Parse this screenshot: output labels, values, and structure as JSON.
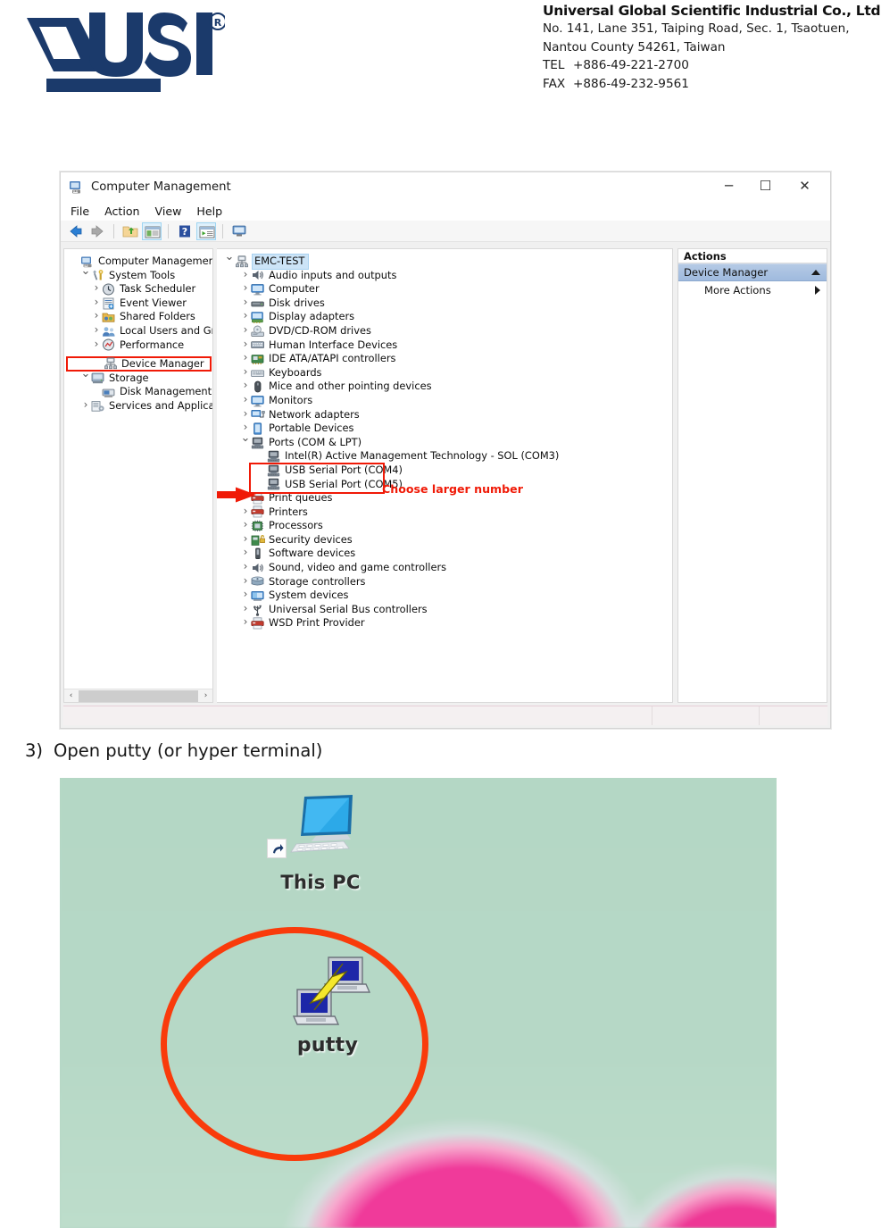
{
  "letterhead": {
    "logo_text": "USI",
    "logo_mark": "usi-logo",
    "company_name": "Universal Global Scientific Industrial Co., Ltd.",
    "address_line1": "No. 141, Lane 351, Taiping Road, Sec. 1, Tsaotuen,",
    "address_line2": "Nantou County 54261, Taiwan",
    "tel_label": "TEL",
    "tel_value": "+886-49-221-2700",
    "fax_label": "FAX",
    "fax_value": "+886-49-232-9561"
  },
  "window": {
    "title": "Computer Management",
    "title_icon": "computer-management-icon",
    "controls": {
      "minimize": "─",
      "maximize": "☐",
      "close": "✕"
    },
    "menu": [
      "File",
      "Action",
      "View",
      "Help"
    ],
    "toolbar_icons": [
      "back-arrow-icon",
      "forward-arrow-icon",
      "up-folder-icon",
      "show-hide-console-tree-icon",
      "help-icon",
      "properties-icon",
      "display-icon"
    ]
  },
  "left_tree": [
    {
      "label": "Computer Management (Local",
      "icon": "computer-management-icon",
      "indent": 0,
      "chev": "none",
      "state": "normal"
    },
    {
      "label": "System Tools",
      "icon": "system-tools-icon",
      "indent": 1,
      "chev": "open",
      "state": "normal"
    },
    {
      "label": "Task Scheduler",
      "icon": "clock-icon",
      "indent": 2,
      "chev": "closed",
      "state": "normal"
    },
    {
      "label": "Event Viewer",
      "icon": "event-viewer-icon",
      "indent": 2,
      "chev": "closed",
      "state": "normal"
    },
    {
      "label": "Shared Folders",
      "icon": "shared-folders-icon",
      "indent": 2,
      "chev": "closed",
      "state": "normal"
    },
    {
      "label": "Local Users and Groups",
      "icon": "users-icon",
      "indent": 2,
      "chev": "closed",
      "state": "normal"
    },
    {
      "label": "Performance",
      "icon": "performance-icon",
      "indent": 2,
      "chev": "closed",
      "state": "normal"
    },
    {
      "label": "Device Manager",
      "icon": "device-manager-icon",
      "indent": 2,
      "chev": "none",
      "state": "highlighted"
    },
    {
      "label": "Storage",
      "icon": "storage-icon",
      "indent": 1,
      "chev": "open",
      "state": "normal"
    },
    {
      "label": "Disk Management",
      "icon": "disk-management-icon",
      "indent": 2,
      "chev": "none",
      "state": "normal"
    },
    {
      "label": "Services and Applications",
      "icon": "services-icon",
      "indent": 1,
      "chev": "closed",
      "state": "normal"
    }
  ],
  "device_tree": [
    {
      "label": "EMC-TEST",
      "icon": "computer-node-icon",
      "indent": 0,
      "chev": "open",
      "state": "selected"
    },
    {
      "label": "Audio inputs and outputs",
      "icon": "speaker-icon",
      "indent": 1,
      "chev": "closed",
      "state": "normal"
    },
    {
      "label": "Computer",
      "icon": "monitor-icon",
      "indent": 1,
      "chev": "closed",
      "state": "normal"
    },
    {
      "label": "Disk drives",
      "icon": "disk-drive-icon",
      "indent": 1,
      "chev": "closed",
      "state": "normal"
    },
    {
      "label": "Display adapters",
      "icon": "display-adapter-icon",
      "indent": 1,
      "chev": "closed",
      "state": "normal"
    },
    {
      "label": "DVD/CD-ROM drives",
      "icon": "dvd-icon",
      "indent": 1,
      "chev": "closed",
      "state": "normal"
    },
    {
      "label": "Human Interface Devices",
      "icon": "hid-icon",
      "indent": 1,
      "chev": "closed",
      "state": "normal"
    },
    {
      "label": "IDE ATA/ATAPI controllers",
      "icon": "ide-controller-icon",
      "indent": 1,
      "chev": "closed",
      "state": "normal"
    },
    {
      "label": "Keyboards",
      "icon": "keyboard-icon",
      "indent": 1,
      "chev": "closed",
      "state": "normal"
    },
    {
      "label": "Mice and other pointing devices",
      "icon": "mouse-icon",
      "indent": 1,
      "chev": "closed",
      "state": "normal"
    },
    {
      "label": "Monitors",
      "icon": "monitor-icon",
      "indent": 1,
      "chev": "closed",
      "state": "normal"
    },
    {
      "label": "Network adapters",
      "icon": "network-adapter-icon",
      "indent": 1,
      "chev": "closed",
      "state": "normal"
    },
    {
      "label": "Portable Devices",
      "icon": "portable-device-icon",
      "indent": 1,
      "chev": "closed",
      "state": "normal"
    },
    {
      "label": "Ports (COM & LPT)",
      "icon": "port-icon",
      "indent": 1,
      "chev": "open",
      "state": "normal"
    },
    {
      "label": "Intel(R) Active Management Technology - SOL (COM3)",
      "icon": "port-icon",
      "indent": 2,
      "chev": "none",
      "state": "normal"
    },
    {
      "label": "USB Serial Port (COM4)",
      "icon": "port-icon",
      "indent": 2,
      "chev": "none",
      "state": "boxed-top"
    },
    {
      "label": "USB Serial Port (COM5)",
      "icon": "port-icon",
      "indent": 2,
      "chev": "none",
      "state": "boxed-bottom"
    },
    {
      "label": "Print queues",
      "icon": "printer-icon",
      "indent": 1,
      "chev": "closed",
      "state": "normal"
    },
    {
      "label": "Printers",
      "icon": "printer-icon",
      "indent": 1,
      "chev": "closed",
      "state": "normal"
    },
    {
      "label": "Processors",
      "icon": "processor-icon",
      "indent": 1,
      "chev": "closed",
      "state": "normal"
    },
    {
      "label": "Security devices",
      "icon": "security-device-icon",
      "indent": 1,
      "chev": "closed",
      "state": "normal"
    },
    {
      "label": "Software devices",
      "icon": "software-device-icon",
      "indent": 1,
      "chev": "closed",
      "state": "normal"
    },
    {
      "label": "Sound, video and game controllers",
      "icon": "speaker-icon",
      "indent": 1,
      "chev": "closed",
      "state": "normal"
    },
    {
      "label": "Storage controllers",
      "icon": "storage-controller-icon",
      "indent": 1,
      "chev": "closed",
      "state": "normal"
    },
    {
      "label": "System devices",
      "icon": "system-device-icon",
      "indent": 1,
      "chev": "closed",
      "state": "normal"
    },
    {
      "label": "Universal Serial Bus controllers",
      "icon": "usb-icon",
      "indent": 1,
      "chev": "closed",
      "state": "normal"
    },
    {
      "label": "WSD Print Provider",
      "icon": "printer-icon",
      "indent": 1,
      "chev": "closed",
      "state": "normal"
    }
  ],
  "actions_pane": {
    "header": "Actions",
    "device_manager": "Device Manager",
    "more_actions": "More Actions"
  },
  "annotations": {
    "choose_larger_number": "Choose larger number",
    "highlight_color": "#f01a07",
    "arrow_color": "#f01a07",
    "circle_color": "#f93b0b"
  },
  "steps": {
    "step3_number": "3)",
    "step3_text": "Open putty (or hyper terminal)"
  },
  "desktop": {
    "background_color": "#b6d8c6",
    "icons": [
      {
        "label": "This PC",
        "icon": "this-pc-icon"
      },
      {
        "label": "putty",
        "icon": "putty-icon"
      }
    ]
  }
}
